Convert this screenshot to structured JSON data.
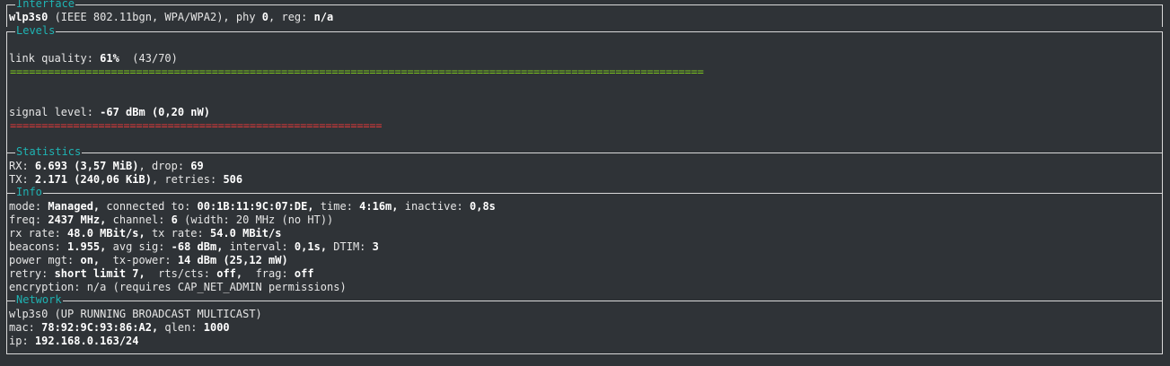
{
  "sections": {
    "interface": "Interface",
    "levels": "Levels",
    "statistics": "Statistics",
    "info": "Info",
    "network": "Network"
  },
  "interface": {
    "name": "wlp3s0",
    "desc": " (IEEE 802.11bgn, WPA/WPA2), phy ",
    "phy": "0",
    "reg_label": ", reg: ",
    "reg": "n/a"
  },
  "levels": {
    "quality_label": "link quality: ",
    "quality_value": "61%",
    "quality_extra": "  (43/70)",
    "quality_fraction": 0.61,
    "signal_label": "signal level: ",
    "signal_value": "-67 dBm",
    "signal_extra": " (0,20 nW)",
    "signal_fraction": 0.33,
    "quality_bar_color": "#7ec81e",
    "signal_bar_color": "#e23a3a"
  },
  "statistics": {
    "rx_label": "RX: ",
    "rx_value": "6.693 (3,57 MiB)",
    "rx_drop_label": ", drop: ",
    "rx_drop": "69",
    "tx_label": "TX: ",
    "tx_value": "2.171 (240,06 KiB)",
    "tx_retries_label": ", retries: ",
    "tx_retries": "506"
  },
  "info": {
    "mode_label": "mode: ",
    "mode": "Managed,",
    "connected_label": " connected to: ",
    "bssid": "00:1B:11:9C:07:DE,",
    "time_label": " time: ",
    "time": "4:16m,",
    "inactive_label": " inactive: ",
    "inactive": "0,8s",
    "freq_label": "freq: ",
    "freq": "2437 MHz,",
    "channel_label": " channel: ",
    "channel": "6",
    "width_text": " (width: 20 MHz (no HT))",
    "rx_rate_label": "rx rate: ",
    "rx_rate": "48.0 MBit/s,",
    "tx_rate_label": " tx rate: ",
    "tx_rate": "54.0 MBit/s",
    "beacons_label": "beacons: ",
    "beacons": "1.955,",
    "avg_sig_label": " avg sig: ",
    "avg_sig": "-68 dBm,",
    "interval_label": " interval: ",
    "interval": "0,1s,",
    "dtim_label": " DTIM: ",
    "dtim": "3",
    "power_label": "power mgt: ",
    "power": "on,",
    "txpower_label": "  tx-power: ",
    "txpower": "14 dBm",
    "txpower_extra": " (25,12 mW)",
    "retry_label": "retry: ",
    "retry": "short limit 7,",
    "rtscts_label": "  rts/cts: ",
    "rtscts": "off,",
    "frag_label": "  frag: ",
    "frag": "off",
    "encryption": "encryption: n/a (requires CAP_NET_ADMIN permissions)"
  },
  "network": {
    "iface": "wlp3s0",
    "flags": " (UP RUNNING BROADCAST MULTICAST)",
    "mac_label": "mac: ",
    "mac": "78:92:9C:93:86:A2,",
    "qlen_label": " qlen: ",
    "qlen": "1000",
    "ip_label": "ip: ",
    "ip": "192.168.0.163/24"
  }
}
